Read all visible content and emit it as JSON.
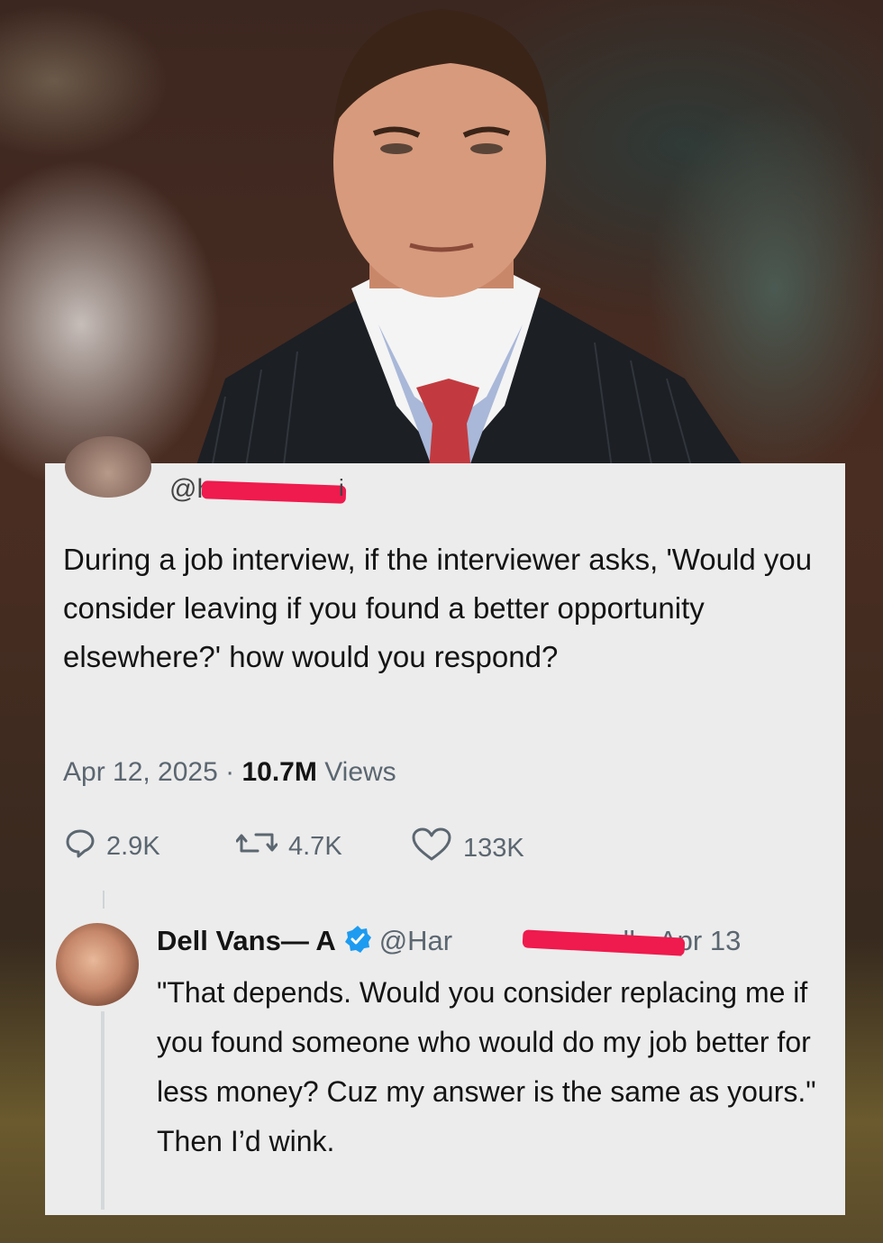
{
  "tweet": {
    "handle": "@h",
    "handle_end": "i",
    "text": "During a job interview, if the interviewer asks, 'Would you consider leaving if you found a better opportunity elsewhere?' how would you respond?",
    "date": "Apr 12, 2025",
    "separator": " · ",
    "views_count": "10.7M",
    "views_label": " Views",
    "replies": "2.9K",
    "retweets": "4.7K",
    "likes": "133K"
  },
  "reply": {
    "name": "Dell Vans— A",
    "handle_start": "@Har",
    "handle_end": "ell",
    "date": " · Apr 13",
    "text": "\"That depends. Would you consider replacing me if you found someone who would do my job better for less money? Cuz my answer is the same as yours.\" Then I’d wink."
  },
  "colors": {
    "card_bg": "#ececec",
    "text_primary": "#141414",
    "text_secondary": "#5b6670",
    "verified": "#1d9bf0",
    "redaction": "#ef1a4d"
  },
  "icons": {
    "reply": "speech-bubble-icon",
    "retweet": "retweet-icon",
    "like": "heart-icon",
    "verified": "verified-badge-icon"
  }
}
